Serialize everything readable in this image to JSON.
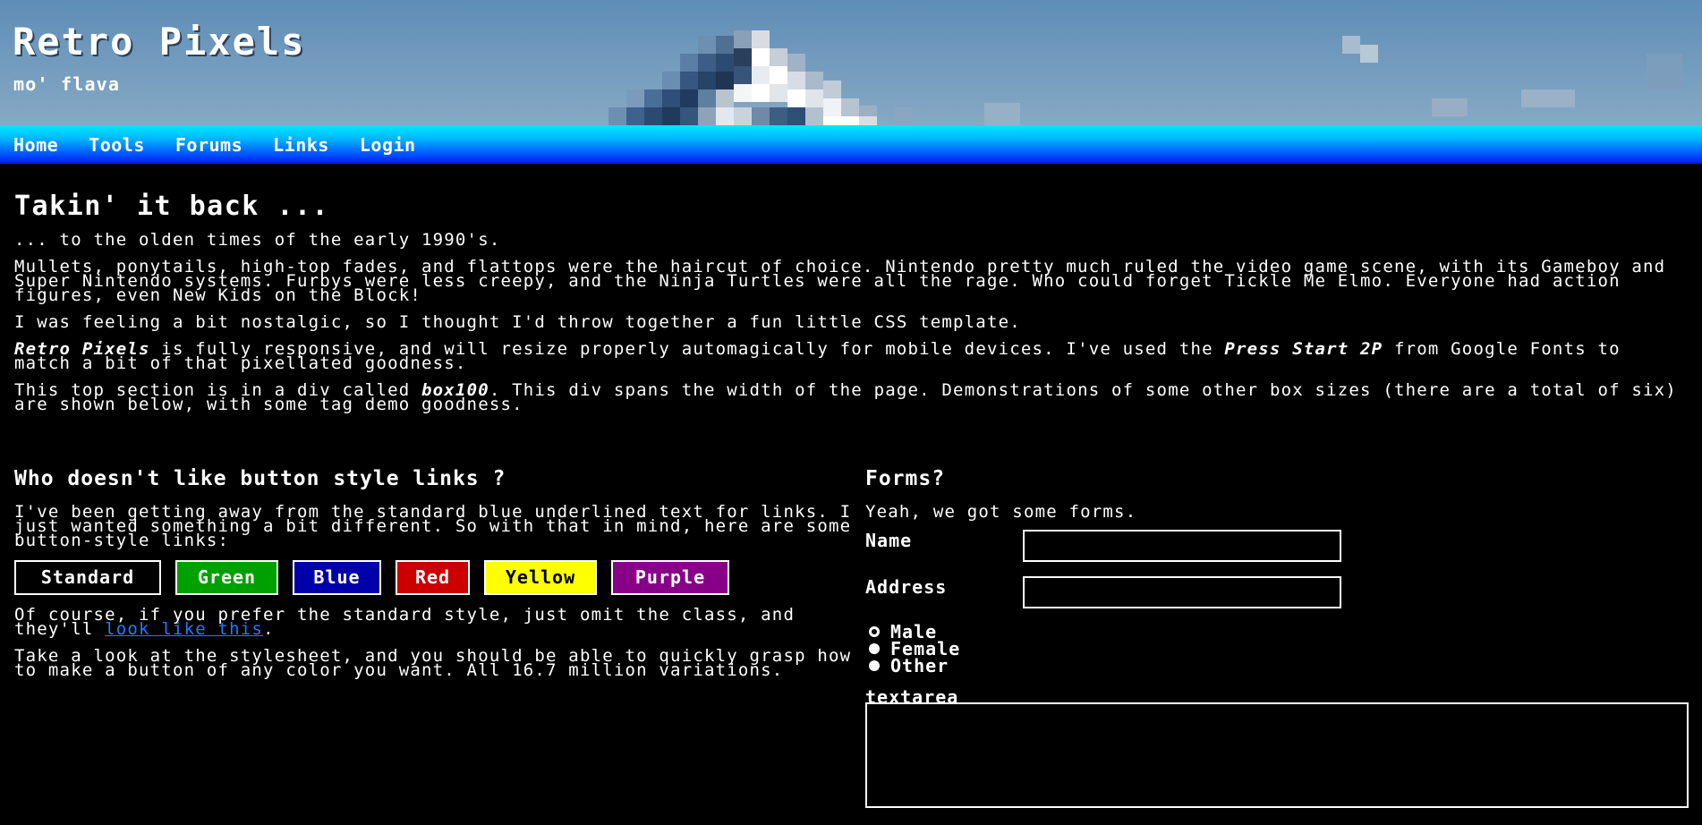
{
  "header": {
    "title": "Retro Pixels",
    "tagline": "mo' flava"
  },
  "nav": {
    "items": [
      {
        "label": "Home"
      },
      {
        "label": "Tools"
      },
      {
        "label": "Forums"
      },
      {
        "label": "Links"
      },
      {
        "label": "Login"
      }
    ]
  },
  "intro": {
    "heading": "Takin' it back ...",
    "p1": "... to the olden times of the early 1990's.",
    "p2": "Mullets, ponytails, high-top fades, and flattops were the haircut of choice. Nintendo pretty much ruled the video game scene, with its Gameboy and Super Nintendo systems. Furbys were less creepy, and the Ninja Turtles were all the rage. Who could forget Tickle Me Elmo. Everyone had action figures, even New Kids on the Block!",
    "p3": "I was feeling a bit nostalgic, so I thought I'd throw together a fun little CSS template.",
    "p4_em": "Retro Pixels",
    "p4_text_a": " is fully responsive, and will resize properly automagically for mobile devices. I've used the ",
    "p4_em2": "Press Start 2P",
    "p4_text_b": " from Google Fonts to match a bit of that pixellated goodness.",
    "p5_text_a": "This top section is in a div called ",
    "p5_em": "box100",
    "p5_text_b": ". This div spans the width of the page. Demonstrations of some other box sizes (there are a total of six) are shown below, with some tag demo goodness."
  },
  "buttons_section": {
    "heading": "Who doesn't like button style links ?",
    "p1": "I've been getting away from the standard blue underlined text for links. I just wanted something a bit different. So with that in mind, here are some button-style links:",
    "buttons": [
      {
        "label": "Standard"
      },
      {
        "label": "Green"
      },
      {
        "label": "Blue"
      },
      {
        "label": "Red"
      },
      {
        "label": "Yellow"
      },
      {
        "label": "Purple"
      }
    ],
    "p2_text_a": "Of course, if you prefer the standard style, just omit the class, and they'll ",
    "p2_link": "look like this",
    "p2_text_b": ".",
    "p3": "Take a look at the stylesheet, and you should be able to quickly grasp how to make a button of any color you want. All 16.7 million variations."
  },
  "forms_section": {
    "heading": "Forms?",
    "intro": "Yeah, we got some forms.",
    "name_label": "Name",
    "name_value": "",
    "address_label": "Address",
    "address_value": "",
    "radios": [
      {
        "label": "Male",
        "selected": true
      },
      {
        "label": "Female",
        "selected": false
      },
      {
        "label": "Other",
        "selected": false
      }
    ],
    "textarea_label": "textarea",
    "textarea_value": ""
  },
  "colors": {
    "background": "#000000",
    "nav_top": "#00eaff",
    "nav_bottom": "#0019ee",
    "link": "#1e7bff",
    "green": "#00a000",
    "blue": "#0000aa",
    "red": "#cc0000",
    "yellow": "#ffff00",
    "purple": "#880088"
  }
}
